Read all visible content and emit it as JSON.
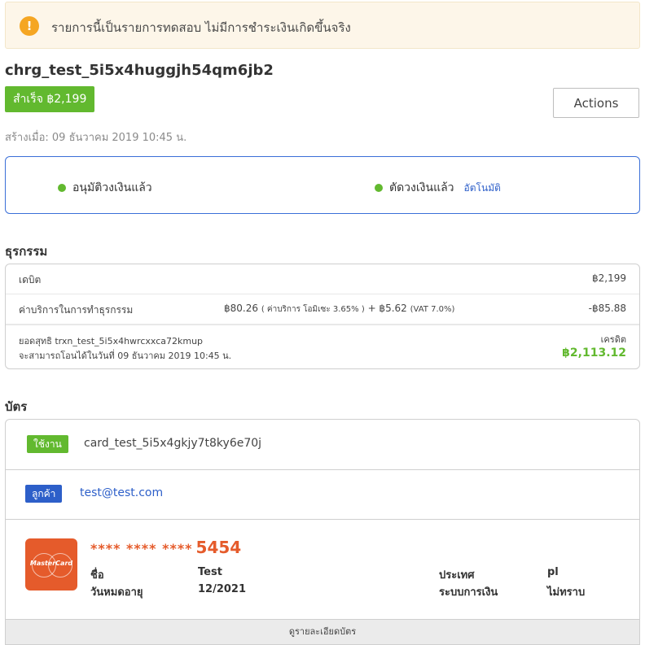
{
  "banner": {
    "icon": "warning-icon",
    "text": "รายการนี้เป็นรายการทดสอบ ไม่มีการชำระเงินเกิดขึ้นจริง"
  },
  "charge": {
    "id": "chrg_test_5i5x4huggjh54qm6jb2",
    "status_badge": "สำเร็จ ฿2,199",
    "actions_label": "Actions",
    "created": "สร้างเมื่อ: 09 ธันวาคม 2019 10:45 น."
  },
  "status": {
    "steps": [
      {
        "label": "อนุมัติวงเงินแล้ว"
      },
      {
        "label": "ตัดวงเงินแล้ว",
        "sub": "อัตโนมัติ"
      }
    ]
  },
  "transactions": {
    "title": "ธุรกรรม",
    "debit": {
      "label": "เดบิต",
      "amount": "฿2,199"
    },
    "fee": {
      "label": "ค่าบริการในการทำธุรกรรม",
      "detail_a": "฿80.26",
      "detail_b": "( ค่าบริการ โอมิเซะ 3.65% )",
      "detail_c": "+ ฿5.62",
      "detail_d": "(VAT 7.0%)",
      "amount": "-฿85.88"
    },
    "net": {
      "line1": "ยอดสุทธิ trxn_test_5i5x4hwrcxxca72kmup",
      "line2": "จะสามารถโอนได้ในวันที่ 09 ธันวาคม 2019 10:45 น.",
      "credit_label": "เครดิต",
      "credit_amount": "฿2,113.12"
    }
  },
  "card": {
    "title": "บัตร",
    "card_tag": "ใช้งาน",
    "card_id": "card_test_5i5x4gkjy7t8ky6e70j",
    "customer_tag": "ลูกค้า",
    "customer_email": "test@test.com",
    "brand": "MasterCard",
    "masked": "**** **** ****",
    "last4": "5454",
    "fields": {
      "name_label": "ชื่อ",
      "name_value": "Test",
      "expiry_label": "วันหมดอายุ",
      "expiry_value": "12/2021",
      "country_label": "ประเทศ",
      "country_value": "pl",
      "bank_label": "ระบบการเงิน",
      "bank_value": "ไม่ทราบ"
    },
    "view_details": "ดูรายละเอียดบัตร"
  },
  "colors": {
    "success": "#62b92f",
    "link": "#2d5fc9",
    "brand_card": "#e55b2b",
    "warning": "#f5a623"
  }
}
